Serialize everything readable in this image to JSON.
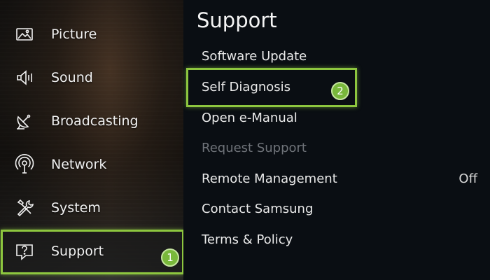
{
  "nav": {
    "items": [
      {
        "label": "Picture",
        "icon": "picture-icon"
      },
      {
        "label": "Sound",
        "icon": "speaker-icon"
      },
      {
        "label": "Broadcasting",
        "icon": "satellite-dish-icon"
      },
      {
        "label": "Network",
        "icon": "network-antenna-icon"
      },
      {
        "label": "System",
        "icon": "tools-icon"
      },
      {
        "label": "Support",
        "icon": "help-box-icon",
        "selected": true
      }
    ],
    "step_badge": "1"
  },
  "support_panel": {
    "title": "Support",
    "items": [
      {
        "label": "Software Update",
        "enabled": true
      },
      {
        "label": "Self Diagnosis",
        "enabled": true,
        "highlighted": true
      },
      {
        "label": "Open e-Manual",
        "enabled": true
      },
      {
        "label": "Request Support",
        "enabled": false
      },
      {
        "label": "Remote Management",
        "enabled": true,
        "value": "Off"
      },
      {
        "label": "Contact Samsung",
        "enabled": true
      },
      {
        "label": "Terms & Policy",
        "enabled": true
      }
    ],
    "step_badge": "2"
  },
  "colors": {
    "highlight": "#8dc63f",
    "badge": "#79b83b",
    "panel_bg": "#0a0e13",
    "disabled_text": "#6f7379"
  }
}
